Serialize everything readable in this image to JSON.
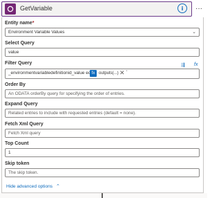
{
  "header": {
    "title": "GetVariable",
    "icon": "connector-icon",
    "actions": [
      "info-icon",
      "more-icon"
    ]
  },
  "form": {
    "entity_name": {
      "label": "Entity name",
      "required_mark": "*",
      "value": "Environment Variable Values"
    },
    "select_query": {
      "label": "Select Query",
      "value": "value"
    },
    "filter_query": {
      "label": "Filter Query",
      "prefix_text": "_environmentvariabledefinitionid_value eq",
      "token_label": "outputs(...)",
      "suffix_text": "'"
    },
    "order_by": {
      "label": "Order By",
      "placeholder": "An ODATA orderBy query for specifying the order of entries."
    },
    "expand_query": {
      "label": "Expand Query",
      "placeholder": "Related entries to include with requested entries (default = none)."
    },
    "fetch_xml_query": {
      "label": "Fetch Xml Query",
      "placeholder": "Fetch Xml query"
    },
    "top_count": {
      "label": "Top Count",
      "value": "1"
    },
    "skip_token": {
      "label": "Skip token",
      "placeholder": "The skip token."
    }
  },
  "footer": {
    "hide_advanced_label": "Hide advanced options"
  },
  "colors": {
    "accent": "#0f6cbd",
    "brand_purple": "#742774",
    "header_border": "#6b3a8a"
  }
}
